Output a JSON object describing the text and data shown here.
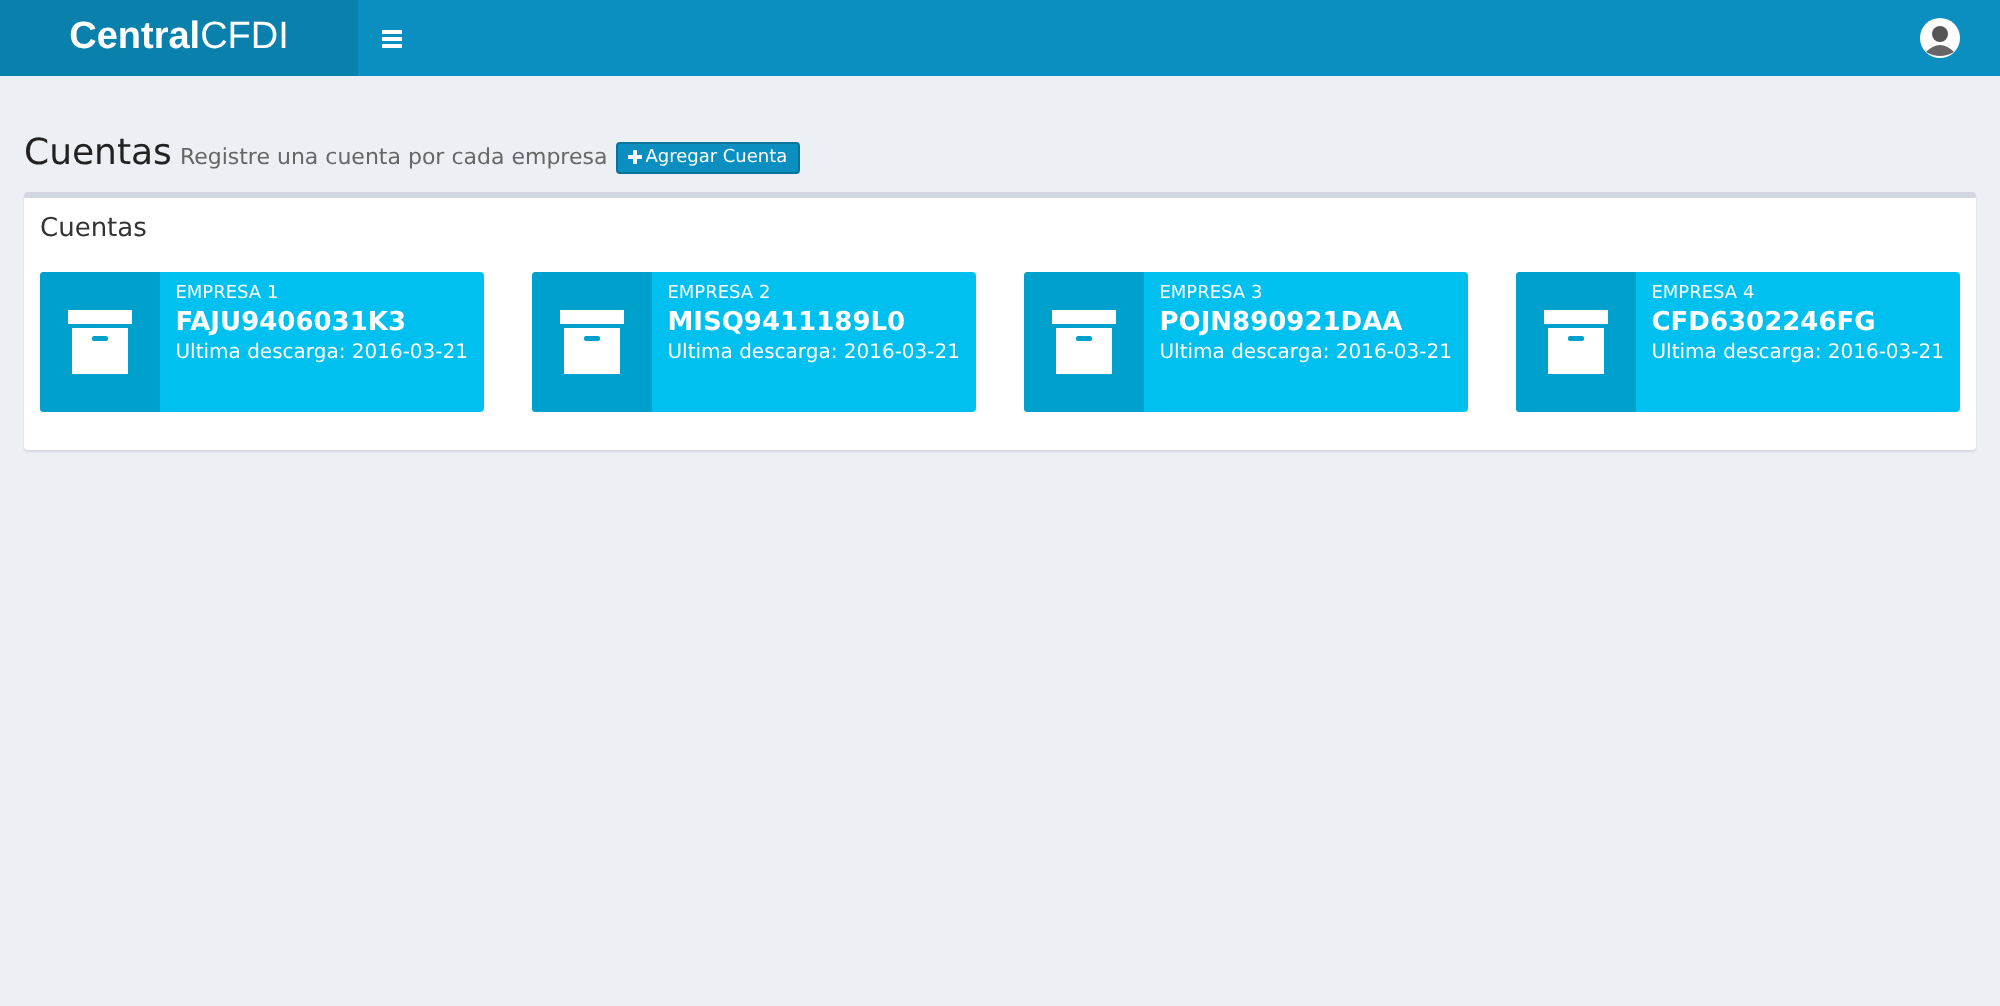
{
  "header": {
    "logo": "**Central**CFDI"
  },
  "page": {
    "title": "Cuentas",
    "subtitle": "Registre una cuenta por cada empresa",
    "add_button": "Agregar Cuenta"
  },
  "panel": {
    "title": "Cuentas",
    "accounts": [
      {
        "label": "EMPRESA 1",
        "rfc": "FAJU9406031K3",
        "last_download": "Ultima descarga: 2016-03-21"
      },
      {
        "label": "EMPRESA 2",
        "rfc": "MISQ9411189L0",
        "last_download": "Ultima descarga: 2016-03-21"
      },
      {
        "label": "EMPRESA 3",
        "rfc": "POJN890921DAA",
        "last_download": "Ultima descarga: 2016-03-21"
      },
      {
        "label": "EMPRESA 4",
        "rfc": "CFD6302246FG",
        "last_download": "Ultima descarga: 2016-03-21"
      }
    ]
  }
}
